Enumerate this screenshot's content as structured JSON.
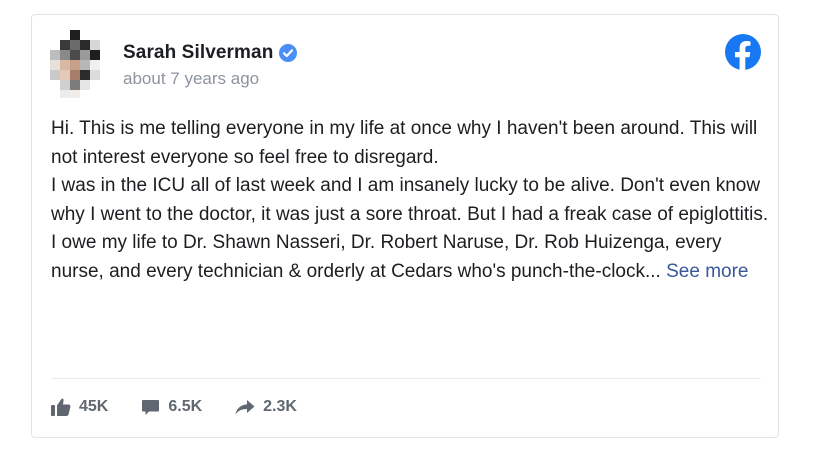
{
  "post": {
    "author": "Sarah Silverman",
    "verified": true,
    "timestamp": "about 7 years ago",
    "paragraphs": [
      "Hi. This is me telling everyone in my life at once why I haven't been around. This will not interest everyone so feel free to disregard.",
      "I was in the ICU all of last week and I am insanely lucky to be alive. Don't even know why I went to the doctor, it was just a sore throat. But I had a freak case of epiglottitis.",
      "I owe my life to Dr. Shawn Nasseri, Dr. Robert Naruse, Dr. Rob Huizenga, every nurse, and every technician & orderly at Cedars who's punch-the-clock..."
    ],
    "see_more_label": "See more"
  },
  "stats": {
    "likes": "45K",
    "comments": "6.5K",
    "shares": "2.3K"
  },
  "icons": {
    "platform": "facebook-logo-icon",
    "verified": "verified-badge-icon",
    "like": "thumbs-up-icon",
    "comment": "comment-bubble-icon",
    "share": "share-arrow-icon"
  },
  "colors": {
    "facebook_blue": "#1877f2",
    "verified_blue": "#4a8ef7",
    "link": "#385898",
    "text": "#1c1e21",
    "muted": "#8d949e",
    "stat": "#606770"
  }
}
